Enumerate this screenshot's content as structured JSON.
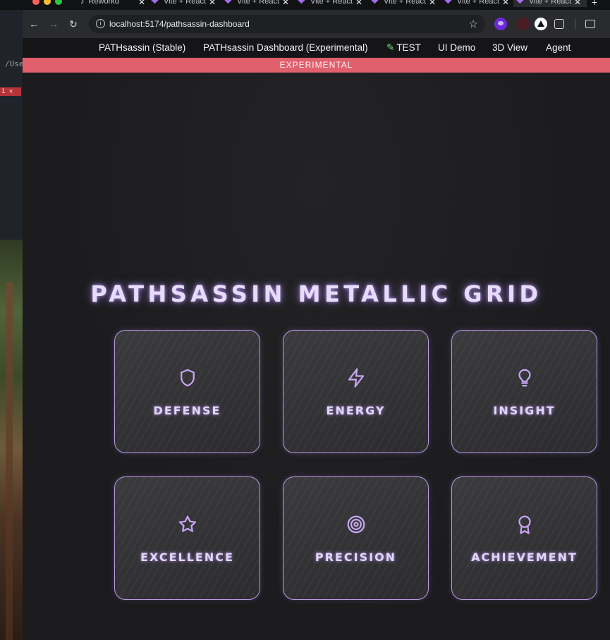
{
  "browser": {
    "tabs": [
      {
        "label": "Reworkd",
        "active": false
      },
      {
        "label": "Vite + React",
        "active": false
      },
      {
        "label": "Vite + React",
        "active": false
      },
      {
        "label": "Vite + React",
        "active": false
      },
      {
        "label": "Vite + React",
        "active": false
      },
      {
        "label": "Vite + React",
        "active": false
      },
      {
        "label": "Vite + React",
        "active": true
      }
    ],
    "url": "localhost:5174/pathsassin-dashboard",
    "background_left_text": "/Use",
    "background_error_text": "1 ✕"
  },
  "nav": {
    "links": [
      "PATHsassin (Stable)",
      "PATHsassin Dashboard (Experimental)",
      "TEST",
      "UI Demo",
      "3D View",
      "Agent"
    ]
  },
  "banner": {
    "label": "EXPERIMENTAL",
    "color": "#e0606e"
  },
  "grid": {
    "title": "PATHSASSIN METALLIC GRID",
    "accent": "#b89ce0",
    "cards": [
      {
        "label": "DEFENSE",
        "icon": "shield-icon"
      },
      {
        "label": "ENERGY",
        "icon": "lightning-icon"
      },
      {
        "label": "INSIGHT",
        "icon": "lightbulb-icon"
      },
      {
        "label": "EXCELLENCE",
        "icon": "star-icon"
      },
      {
        "label": "PRECISION",
        "icon": "target-icon"
      },
      {
        "label": "ACHIEVEMENT",
        "icon": "award-icon"
      }
    ]
  }
}
